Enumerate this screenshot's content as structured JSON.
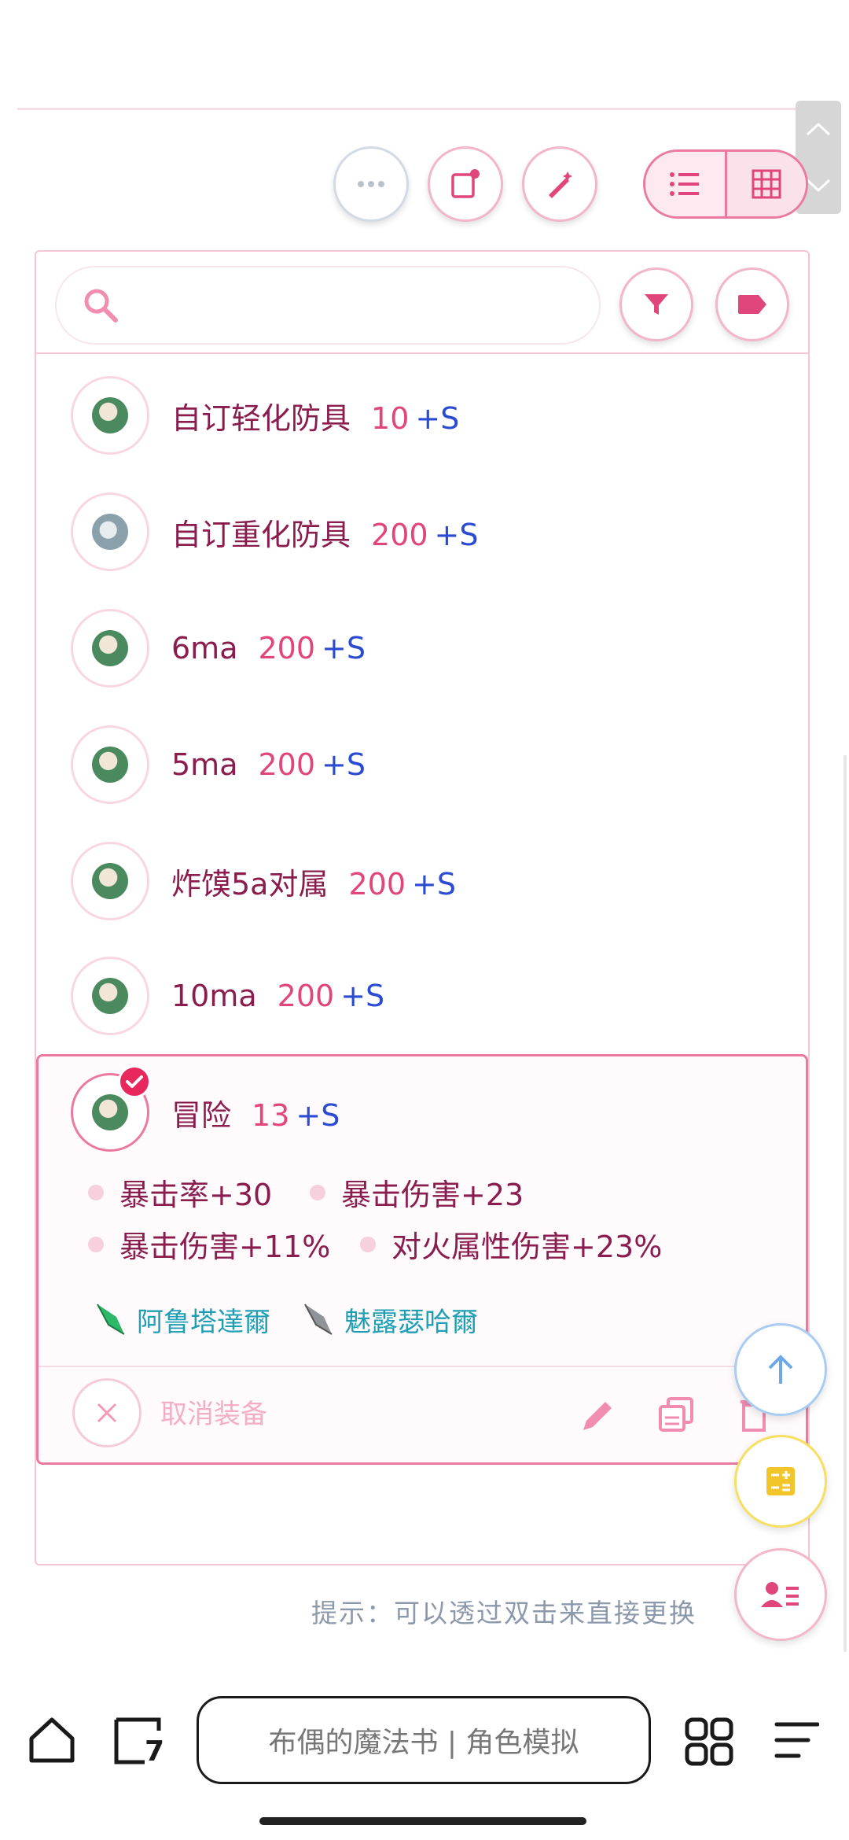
{
  "search": {
    "placeholder": ""
  },
  "items": [
    {
      "name": "自订轻化防具",
      "value": "10",
      "suffix": "+S",
      "icon": "armor-light-icon"
    },
    {
      "name": "自订重化防具",
      "value": "200",
      "suffix": "+S",
      "icon": "armor-heavy-icon"
    },
    {
      "name": "6ma",
      "value": "200",
      "suffix": "+S",
      "icon": "armor-light-icon"
    },
    {
      "name": "5ma",
      "value": "200",
      "suffix": "+S",
      "icon": "armor-light-icon"
    },
    {
      "name": "炸馍5a对属",
      "value": "200",
      "suffix": "+S",
      "icon": "armor-light-icon"
    },
    {
      "name": "10ma",
      "value": "200",
      "suffix": "+S",
      "icon": "armor-light-icon"
    }
  ],
  "selected": {
    "name": "冒险",
    "value": "13",
    "suffix": "+S",
    "attributes": [
      "暴击率+30",
      "暴击伤害+23",
      "暴击伤害+11%",
      "对火属性伤害+23%"
    ],
    "gems": [
      "阿鲁塔達爾",
      "魅露瑟哈爾"
    ],
    "cancel_label": "取消装备"
  },
  "hint": "提示：可以透过双击来直接更换",
  "browser": {
    "url_text": "布偶的魔法书 | 角色模拟",
    "tab_count": "7"
  },
  "colors": {
    "accent": "#ec7aa0",
    "name": "#8a1d4e",
    "value": "#e0457b",
    "plus": "#2a4bd2",
    "gem": "#1f9fb4"
  }
}
